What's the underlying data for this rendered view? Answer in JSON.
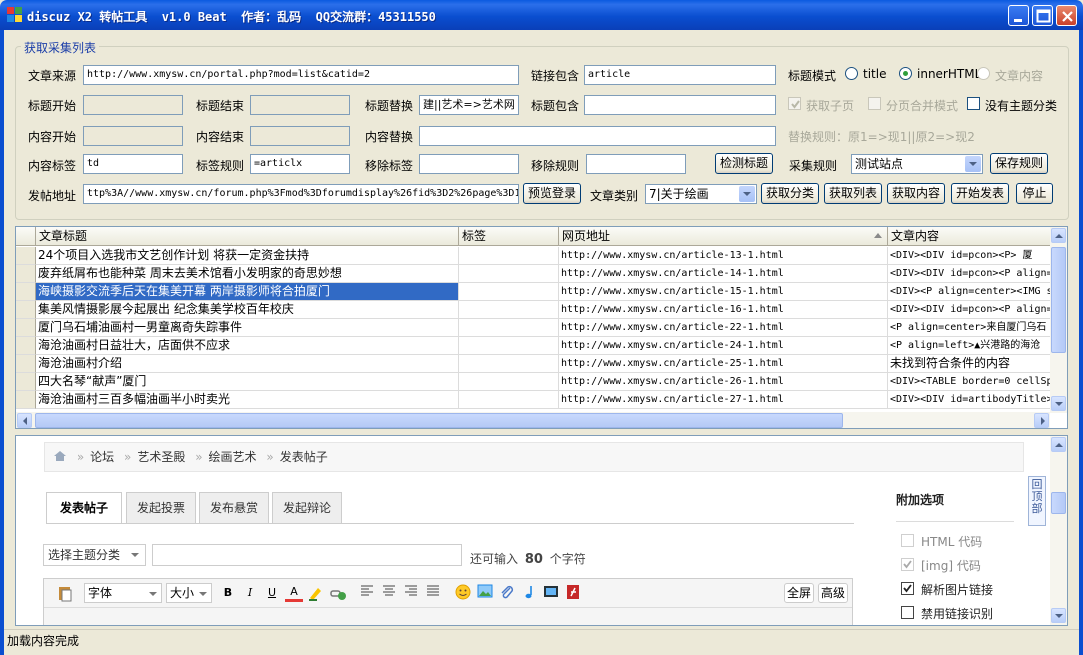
{
  "window": {
    "title": "discuz X2 转帖工具  v1.0 Beat  作者：乱码  QQ交流群：45311550"
  },
  "group": {
    "legend": "获取采集列表",
    "source_label": "文章来源",
    "source_value": "http://www.xmysw.cn/portal.php?mod=list&catid=2",
    "link_contains_label": "链接包含",
    "link_contains_value": "article",
    "title_mode_label": "标题模式",
    "title_mode_options": [
      "title",
      "innerHTML",
      "文章内容"
    ],
    "title_start_label": "标题开始",
    "title_end_label": "标题结束",
    "title_replace_label": "标题替换",
    "title_replace_value": "建||艺术=>艺术网",
    "title_contains_label": "标题包含",
    "get_subpage_label": "获取子页",
    "paging_merge_label": "分页合并模式",
    "no_subject_label": "没有主题分类",
    "content_start_label": "内容开始",
    "content_end_label": "内容结束",
    "content_replace_label": "内容替换",
    "replace_rule_hint": "替换规则：原1=>现1||原2=>现2",
    "content_tag_label": "内容标签",
    "content_tag_value": "td",
    "tag_rule_label": "标签规则",
    "tag_rule_value": "=articlx",
    "remove_tag_label": "移除标签",
    "remove_rule_label": "移除规则",
    "detect_title_btn": "检测标题",
    "collect_rule_label": "采集规则",
    "collect_rule_value": "测试站点",
    "save_rule_btn": "保存规则",
    "post_url_label": "发帖地址",
    "post_url_value": "ttp%3A//www.xmysw.cn/forum.php%3Fmod%3Dforumdisplay%26fid%3D2%26page%3D1",
    "preview_login_btn": "预览登录",
    "category_label": "文章类别",
    "category_value": "7|关于绘画",
    "get_category_btn": "获取分类",
    "get_list_btn": "获取列表",
    "get_content_btn": "获取内容",
    "start_post_btn": "开始发表",
    "stop_btn": "停止"
  },
  "table": {
    "columns": [
      "文章标题",
      "标签",
      "网页地址",
      "文章内容"
    ],
    "rows": [
      {
        "title": "24个项目入选我市文艺创作计划 将获一定资金扶持",
        "tag": "",
        "url": "http://www.xmysw.cn/article-13-1.html",
        "content": "<DIV><DIV id=pcon><P>    厦"
      },
      {
        "title": "废弃纸屑布也能种菜 周末去美术馆看小发明家的奇思妙想",
        "tag": "",
        "url": "http://www.xmysw.cn/article-14-1.html",
        "content": "<DIV><DIV id=pcon><P align="
      },
      {
        "title": "海峡摄影交流季后天在集美开幕 两岸摄影师将合拍厦门",
        "tag": "",
        "url": "http://www.xmysw.cn/article-15-1.html",
        "content": "<DIV><P align=center><IMG s"
      },
      {
        "title": "集美风情摄影展今起展出 纪念集美学校百年校庆",
        "tag": "",
        "url": "http://www.xmysw.cn/article-16-1.html",
        "content": "<DIV><DIV id=pcon><P align="
      },
      {
        "title": "厦门乌石埔油画村一男童离奇失踪事件",
        "tag": "",
        "url": "http://www.xmysw.cn/article-22-1.html",
        "content": "<P align=center>来自厦门乌石"
      },
      {
        "title": "海沧油画村日益壮大，店面供不应求",
        "tag": "",
        "url": "http://www.xmysw.cn/article-24-1.html",
        "content": "<P align=left>▲兴港路的海沧"
      },
      {
        "title": "海沧油画村介绍",
        "tag": "",
        "url": "http://www.xmysw.cn/article-25-1.html",
        "content": "未找到符合条件的内容"
      },
      {
        "title": "四大名琴“献声”厦门",
        "tag": "",
        "url": "http://www.xmysw.cn/article-26-1.html",
        "content": "<DIV><TABLE border=0 cellSp"
      },
      {
        "title": "海沧油画村三百多幅油画半小时卖光",
        "tag": "",
        "url": "http://www.xmysw.cn/article-27-1.html",
        "content": "<DIV><DIV id=artibodyTitle>"
      }
    ]
  },
  "browser": {
    "breadcrumb": [
      "论坛",
      "艺术圣殿",
      "绘画艺术",
      "发表帖子"
    ],
    "tabs": [
      "发表帖子",
      "发起投票",
      "发布悬赏",
      "发起辩论"
    ],
    "subject_select": "选择主题分类",
    "remaining_prefix": "还可输入",
    "remaining_count": "80",
    "remaining_suffix": "个字符",
    "font_select": "字体",
    "size_select": "大小",
    "fullscreen_btn": "全屏",
    "advanced_btn": "高级",
    "side_title": "附加选项",
    "options": [
      {
        "label": "HTML 代码",
        "checked": false,
        "disabled": true
      },
      {
        "label": "[img] 代码",
        "checked": true,
        "disabled": true
      },
      {
        "label": "解析图片链接",
        "checked": true,
        "disabled": false
      },
      {
        "label": "禁用链接识别",
        "checked": false,
        "disabled": false
      }
    ],
    "back_to_top": "回顶部"
  },
  "status": "加载内容完成",
  "colors": {
    "titlebar": "#0a4ed0",
    "selection": "#316ac5",
    "legend": "#1a3da8"
  }
}
